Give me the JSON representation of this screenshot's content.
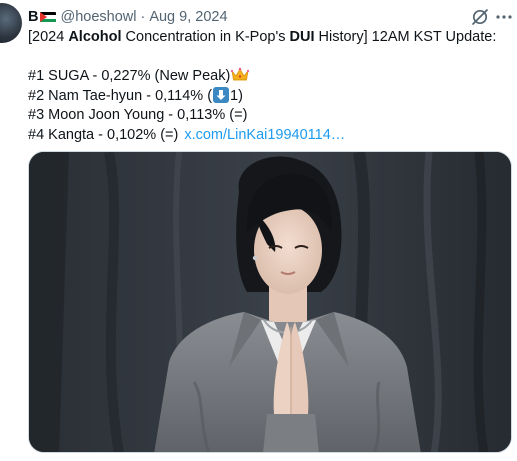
{
  "user": {
    "display_name": "B",
    "handle": "@hoeshowl",
    "separator": "·",
    "date": "Aug 9, 2024"
  },
  "post": {
    "line1_a": "[2024 ",
    "line1_b": "Alcohol",
    "line1_c": " Concentration in K-Pop's ",
    "line1_d": "DUI",
    "line1_e": " History] 12AM KST Update:",
    "rank1": "#1 SUGA - 0,227%  (New Peak)",
    "rank2_a": "#2 Nam Tae-hyun - 0,114% (",
    "rank2_b": "1)",
    "rank3": "#3 Moon Joon Young - 0,113% (=)",
    "rank4": "#4 Kangta - 0,102% (=)",
    "link": "x.com/LinKai19940114…"
  },
  "icons": {
    "flag": "palestine-flag-icon",
    "grok": "grok-icon",
    "more": "more-icon",
    "crown": "crown-emoji-icon",
    "down": "down-arrow-emoji-icon"
  },
  "colors": {
    "text": "#0f1419",
    "muted": "#536471",
    "link": "#1d9bf0"
  }
}
